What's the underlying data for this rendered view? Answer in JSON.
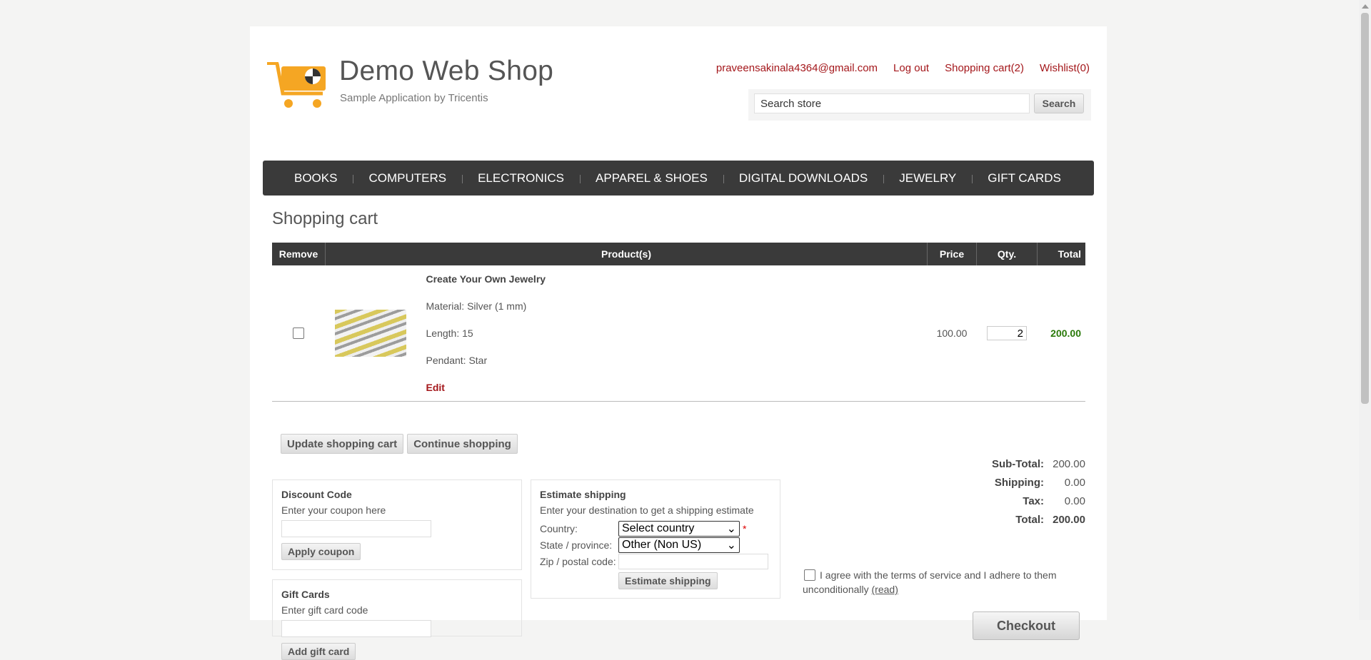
{
  "header": {
    "site_title": "Demo Web Shop",
    "site_subtitle": "Sample Application by Tricentis",
    "links": [
      "praveensakinala4364@gmail.com",
      "Log out",
      "Shopping cart(2)",
      "Wishlist(0)"
    ],
    "search_placeholder": "Search store",
    "search_button": "Search"
  },
  "nav": [
    "BOOKS",
    "COMPUTERS",
    "ELECTRONICS",
    "APPAREL & SHOES",
    "DIGITAL DOWNLOADS",
    "JEWELRY",
    "GIFT CARDS"
  ],
  "page_title": "Shopping cart",
  "cart": {
    "columns": [
      "Remove",
      "Product(s)",
      "Price",
      "Qty.",
      "Total"
    ],
    "item": {
      "name": "Create Your Own Jewelry",
      "attributes": [
        "Material: Silver (1 mm)",
        "Length: 15",
        "Pendant: Star"
      ],
      "edit": "Edit",
      "price": "100.00",
      "qty": "2",
      "total": "200.00"
    },
    "update_button": "Update shopping cart",
    "continue_button": "Continue shopping"
  },
  "discount": {
    "title": "Discount Code",
    "hint": "Enter your coupon here",
    "button": "Apply coupon"
  },
  "giftcard": {
    "title": "Gift Cards",
    "hint": "Enter gift card code",
    "button": "Add gift card"
  },
  "shipping": {
    "title": "Estimate shipping",
    "hint": "Enter your destination to get a shipping estimate",
    "country_label": "Country:",
    "country_value": "Select country",
    "state_label": "State / province:",
    "state_value": "Other (Non US)",
    "zip_label": "Zip / postal code:",
    "button": "Estimate shipping",
    "required_mark": "*"
  },
  "totals": {
    "subtotal_label": "Sub-Total:",
    "subtotal": "200.00",
    "shipping_label": "Shipping:",
    "shipping": "0.00",
    "tax_label": "Tax:",
    "tax": "0.00",
    "total_label": "Total:",
    "total": "200.00"
  },
  "terms": {
    "text": "I agree with the terms of service and I adhere to them unconditionally",
    "read": "(read)"
  },
  "checkout_button": "Checkout",
  "colors": {
    "accent": "#a4171b",
    "nav_bg": "#3a3a3a",
    "total_green": "#2a7a0a"
  }
}
